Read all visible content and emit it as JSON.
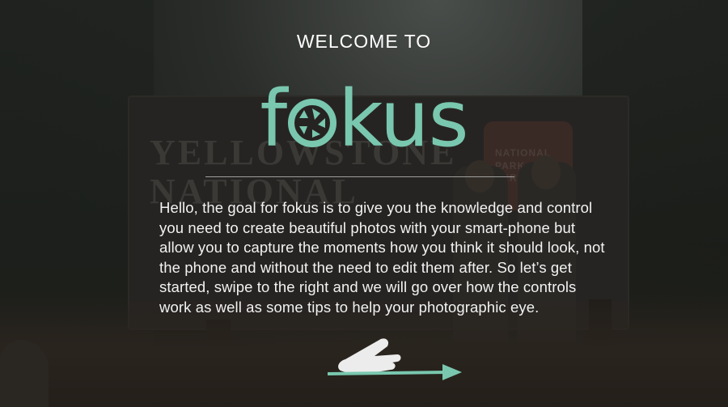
{
  "background": {
    "sign_text": "YELLOWSTONE\nNATIONAL",
    "badge_text": "NATIONAL\nPARK\nSERVICE"
  },
  "welcome": {
    "title": "WELCOME TO",
    "logo_text_prefix": "f",
    "logo_text_suffix": "kus",
    "logo_full": "fokus",
    "body": "Hello, the goal for fokus is to give you the knowledge and control you need to create beautiful photos with your smart-phone but allow you to capture the moments how you think it should look, not the phone and without the need to edit them after. So let’s get started, swipe to the right and we will go over how the controls work as well as some tips to help your photographic eye."
  },
  "colors": {
    "accent": "#79c7ae",
    "text": "#ffffff"
  },
  "icons": {
    "logo_o": "aperture-icon",
    "swipe": "swipe-right-hand-icon"
  }
}
